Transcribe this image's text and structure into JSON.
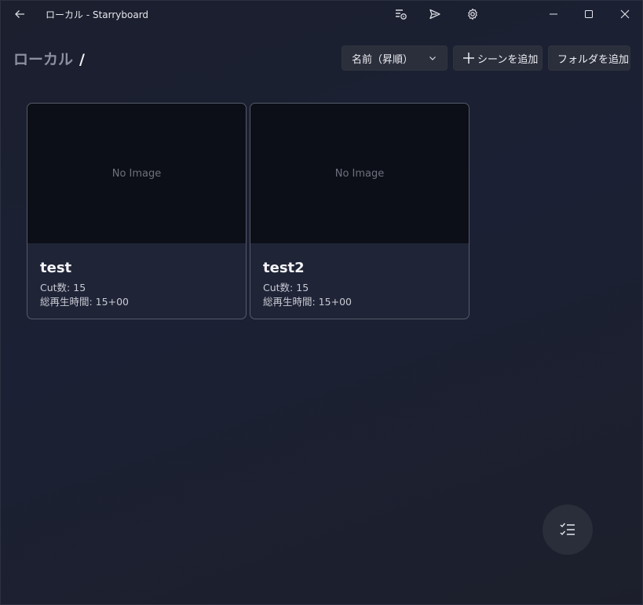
{
  "window": {
    "title": "ローカル - Starryboard",
    "titlebar_icons": [
      "playlist-icon",
      "send-icon",
      "gear-icon"
    ],
    "window_controls": [
      "minimize-icon",
      "maximize-icon",
      "close-icon"
    ]
  },
  "breadcrumb": {
    "root": "ローカル",
    "separator": "/"
  },
  "toolbar": {
    "sort_label": "名前（昇順）",
    "add_scene_label": "シーンを追加",
    "add_folder_label": "フォルダを追加"
  },
  "scenes": [
    {
      "thumbnail_text": "No Image",
      "name": "test",
      "cut_count": "Cut数: 15",
      "total_duration": "総再生時間: 15+00"
    },
    {
      "thumbnail_text": "No Image",
      "name": "test2",
      "cut_count": "Cut数: 15",
      "total_duration": "総再生時間: 15+00"
    }
  ],
  "fab": {
    "icon": "checklist-icon"
  },
  "colors": {
    "background": "#1b1f2e",
    "card_background": "#1f2437",
    "thumbnail_background": "#0c0f17",
    "button_background": "#2b2f3c"
  }
}
